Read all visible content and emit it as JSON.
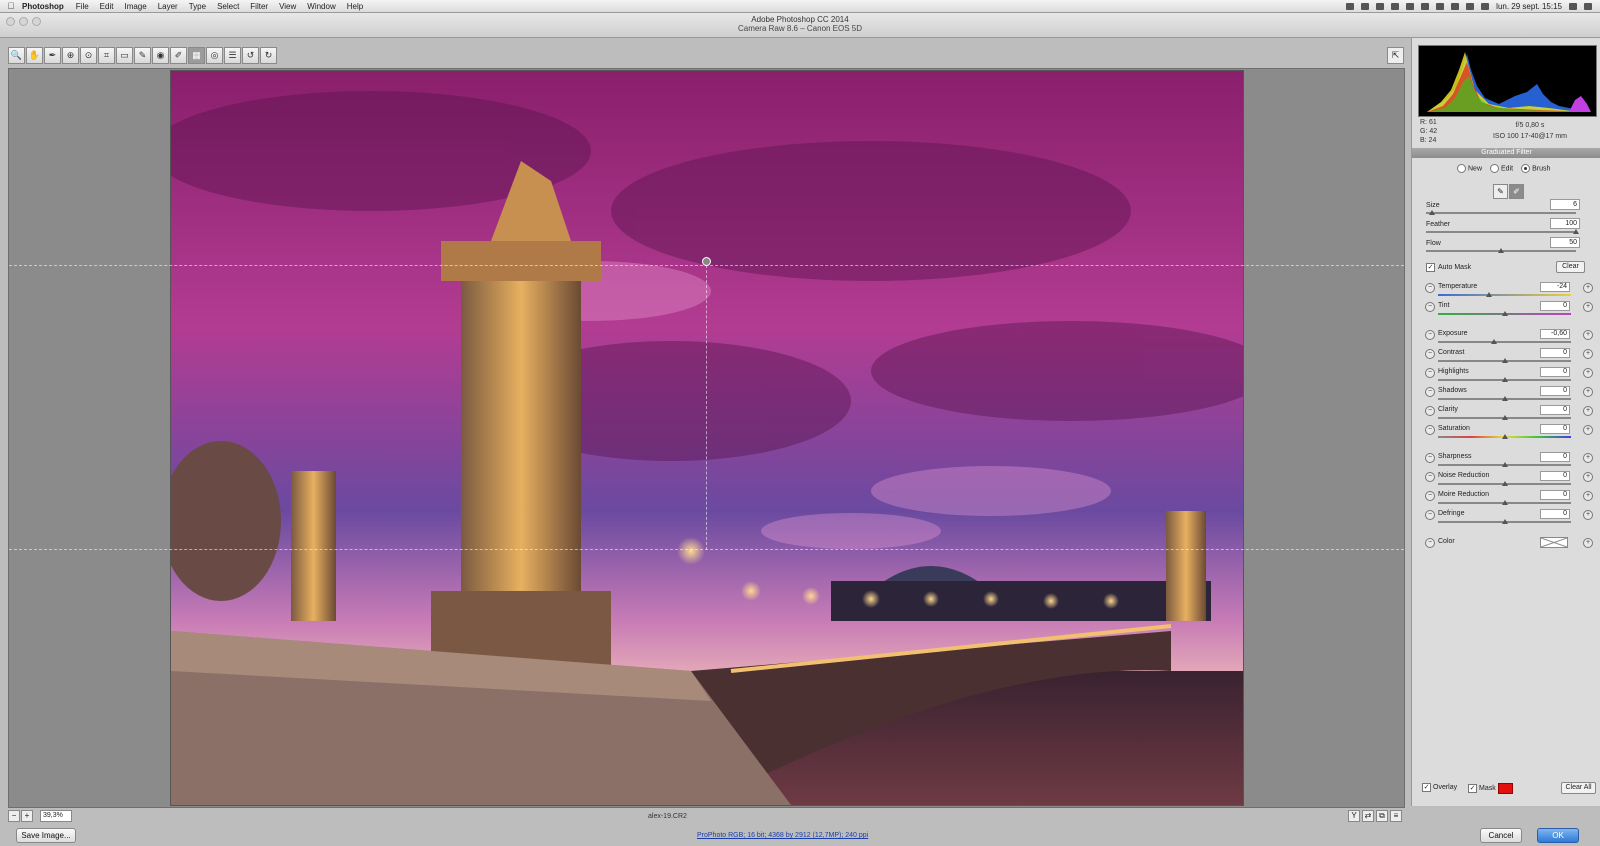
{
  "menubar": {
    "app": "Photoshop",
    "items": [
      "File",
      "Edit",
      "Image",
      "Layer",
      "Type",
      "Select",
      "Filter",
      "View",
      "Window",
      "Help"
    ],
    "clock": "lun. 29 sept.  15:15"
  },
  "window": {
    "title": "Adobe Photoshop CC 2014",
    "subtitle": "Camera Raw 8.6  –  Canon EOS 5D"
  },
  "toolbar": {
    "tools": [
      {
        "name": "zoom-tool-icon",
        "glyph": "🔍"
      },
      {
        "name": "hand-tool-icon",
        "glyph": "✋"
      },
      {
        "name": "white-balance-tool-icon",
        "glyph": "✒"
      },
      {
        "name": "color-sampler-tool-icon",
        "glyph": "⊕"
      },
      {
        "name": "targeted-adjustment-tool-icon",
        "glyph": "⊙"
      },
      {
        "name": "crop-tool-icon",
        "glyph": "⌗"
      },
      {
        "name": "straighten-tool-icon",
        "glyph": "▭"
      },
      {
        "name": "spot-removal-tool-icon",
        "glyph": "✎"
      },
      {
        "name": "red-eye-tool-icon",
        "glyph": "◉"
      },
      {
        "name": "adjustment-brush-icon",
        "glyph": "✐"
      },
      {
        "name": "graduated-filter-icon",
        "glyph": "▦"
      },
      {
        "name": "radial-filter-icon",
        "glyph": "◎"
      },
      {
        "name": "preferences-icon",
        "glyph": "☰"
      },
      {
        "name": "rotate-ccw-icon",
        "glyph": "↺"
      },
      {
        "name": "rotate-cw-icon",
        "glyph": "↻"
      }
    ],
    "active_index": 10
  },
  "readout": {
    "r": "R:   61",
    "g": "G:   42",
    "b": "B:   24",
    "aperture_shutter": "f/5    0,80 s",
    "iso_lens": "ISO 100    17-40@17 mm"
  },
  "panel": {
    "title": "Graduated Filter",
    "modes": [
      "New",
      "Edit",
      "Brush"
    ],
    "selected_mode": "Brush",
    "brush": [
      {
        "label": "Size",
        "value": "6",
        "pos": 0.04
      },
      {
        "label": "Feather",
        "value": "100",
        "pos": 1.0
      },
      {
        "label": "Flow",
        "value": "50",
        "pos": 0.5
      }
    ],
    "auto_mask_label": "Auto Mask",
    "auto_mask_checked": true,
    "clear_label": "Clear",
    "adjustments": [
      {
        "label": "Temperature",
        "value": "-24",
        "pos": 0.38
      },
      {
        "label": "Tint",
        "value": "0",
        "pos": 0.5
      },
      {
        "label": "Exposure",
        "value": "-0,60",
        "pos": 0.42
      },
      {
        "label": "Contrast",
        "value": "0",
        "pos": 0.5
      },
      {
        "label": "Highlights",
        "value": "0",
        "pos": 0.5
      },
      {
        "label": "Shadows",
        "value": "0",
        "pos": 0.5
      },
      {
        "label": "Clarity",
        "value": "0",
        "pos": 0.5
      },
      {
        "label": "Saturation",
        "value": "0",
        "pos": 0.5
      },
      {
        "label": "Sharpness",
        "value": "0",
        "pos": 0.5
      },
      {
        "label": "Noise Reduction",
        "value": "0",
        "pos": 0.5
      },
      {
        "label": "Moire Reduction",
        "value": "0",
        "pos": 0.5
      },
      {
        "label": "Defringe",
        "value": "0",
        "pos": 0.5
      }
    ],
    "color_label": "Color",
    "overlay_label": "Overlay",
    "mask_label": "Mask",
    "mask_color": "#e11111",
    "clear_all_label": "Clear All"
  },
  "status": {
    "zoom": "39,3%",
    "filename": "alex-19.CR2"
  },
  "footer": {
    "save_label": "Save Image...",
    "workflow_link": "ProPhoto RGB; 16 bit; 4368 by 2912 (12,7MP); 240 ppi",
    "cancel_label": "Cancel",
    "ok_label": "OK"
  }
}
